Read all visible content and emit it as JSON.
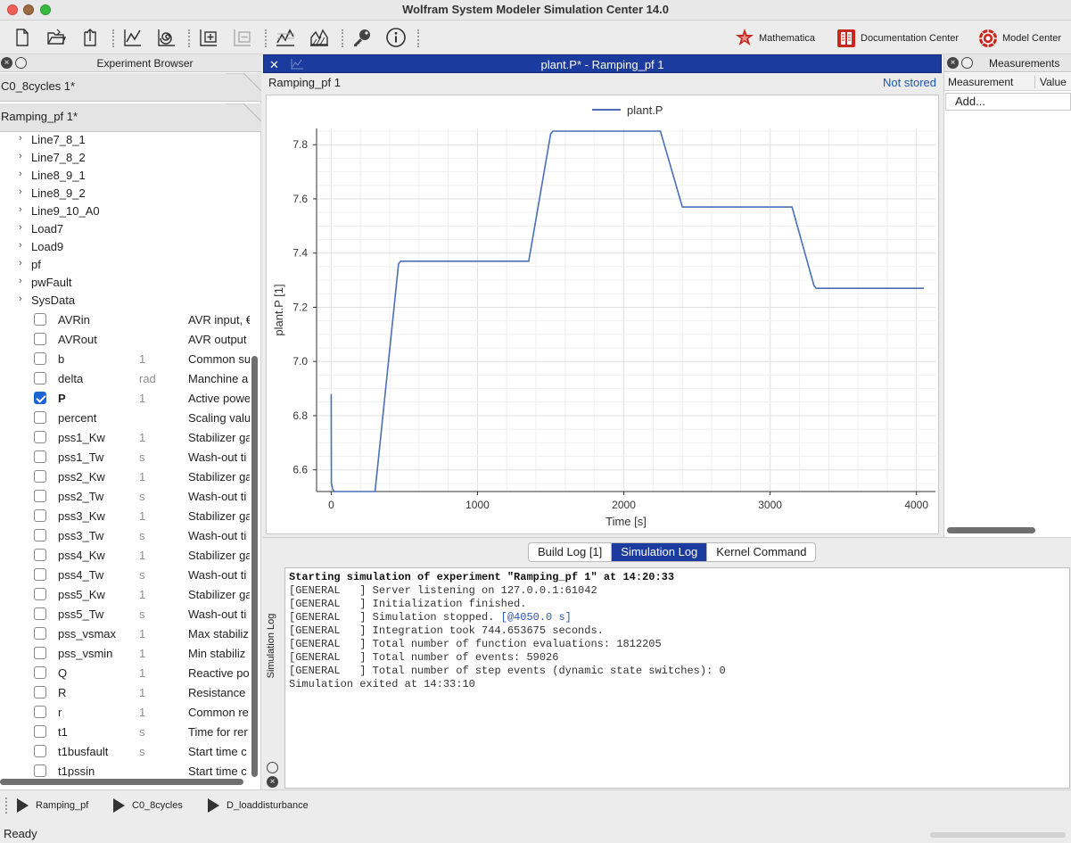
{
  "window": {
    "title": "Wolfram System Modeler Simulation Center 14.0"
  },
  "toolbar": {
    "icons": [
      "new-file-icon",
      "open-folder-icon",
      "export-icon",
      "plot-icon",
      "spiral-plot-icon",
      "add-plot-icon",
      "remove-plot-icon",
      "line-chart-icon",
      "area-chart-icon",
      "key-icon",
      "info-icon"
    ],
    "apps": [
      {
        "label": "Mathematica",
        "icon": "mathematica-icon"
      },
      {
        "label": "Documentation Center",
        "icon": "documentation-icon"
      },
      {
        "label": "Model Center",
        "icon": "model-center-icon"
      }
    ],
    "accent": "#c8281d"
  },
  "experiment_browser": {
    "title": "Experiment Browser",
    "experiments": [
      "C0_8cycles 1*",
      "Ramping_pf 1*"
    ],
    "tree_nodes": [
      "Line7_8_1",
      "Line7_8_2",
      "Line8_9_1",
      "Line8_9_2",
      "Line9_10_A0",
      "Load7",
      "Load9",
      "pf",
      "pwFault",
      "SysData"
    ],
    "variables": [
      {
        "name": "AVRin",
        "unit": "",
        "desc": "AVR input, €",
        "checked": false
      },
      {
        "name": "AVRout",
        "unit": "",
        "desc": "AVR output",
        "checked": false
      },
      {
        "name": "b",
        "unit": "1",
        "desc": "Common su",
        "checked": false
      },
      {
        "name": "delta",
        "unit": "rad",
        "desc": "Manchine a",
        "checked": false
      },
      {
        "name": "P",
        "unit": "1",
        "desc": "Active powe",
        "checked": true
      },
      {
        "name": "percent",
        "unit": "",
        "desc": "Scaling valu",
        "checked": false
      },
      {
        "name": "pss1_Kw",
        "unit": "1",
        "desc": "Stabilizer ga",
        "checked": false
      },
      {
        "name": "pss1_Tw",
        "unit": "s",
        "desc": "Wash-out ti",
        "checked": false
      },
      {
        "name": "pss2_Kw",
        "unit": "1",
        "desc": "Stabilizer ga",
        "checked": false
      },
      {
        "name": "pss2_Tw",
        "unit": "s",
        "desc": "Wash-out ti",
        "checked": false
      },
      {
        "name": "pss3_Kw",
        "unit": "1",
        "desc": "Stabilizer ga",
        "checked": false
      },
      {
        "name": "pss3_Tw",
        "unit": "s",
        "desc": "Wash-out ti",
        "checked": false
      },
      {
        "name": "pss4_Kw",
        "unit": "1",
        "desc": "Stabilizer ga",
        "checked": false
      },
      {
        "name": "pss4_Tw",
        "unit": "s",
        "desc": "Wash-out ti",
        "checked": false
      },
      {
        "name": "pss5_Kw",
        "unit": "1",
        "desc": "Stabilizer ga",
        "checked": false
      },
      {
        "name": "pss5_Tw",
        "unit": "s",
        "desc": "Wash-out ti",
        "checked": false
      },
      {
        "name": "pss_vsmax",
        "unit": "1",
        "desc": "Max stabiliz",
        "checked": false
      },
      {
        "name": "pss_vsmin",
        "unit": "1",
        "desc": "Min stabiliz",
        "checked": false
      },
      {
        "name": "Q",
        "unit": "1",
        "desc": "Reactive po",
        "checked": false
      },
      {
        "name": "R",
        "unit": "1",
        "desc": "Resistance",
        "checked": false
      },
      {
        "name": "r",
        "unit": "1",
        "desc": "Common re",
        "checked": false
      },
      {
        "name": "t1",
        "unit": "s",
        "desc": "Time for rer",
        "checked": false
      },
      {
        "name": "t1busfault",
        "unit": "s",
        "desc": "Start time c",
        "checked": false
      },
      {
        "name": "t1pssin",
        "unit": "",
        "desc": "Start time c",
        "checked": false
      }
    ]
  },
  "plot_window": {
    "title": "plant.P* - Ramping_pf 1",
    "experiment_label": "Ramping_pf 1",
    "storage_status": "Not stored",
    "accent": "#1c3b9e"
  },
  "chart_data": {
    "type": "line",
    "xlabel": "Time [s]",
    "ylabel": "plant.P [1]",
    "xlim": [
      -100,
      4130
    ],
    "ylim": [
      6.52,
      7.86
    ],
    "xticks": [
      0,
      1000,
      2000,
      3000,
      4000
    ],
    "yticks": [
      6.6,
      6.8,
      7.0,
      7.2,
      7.4,
      7.6,
      7.8
    ],
    "grid": true,
    "legend_position": "top-center",
    "series": [
      {
        "name": "plant.P",
        "color": "#4a6fb5",
        "x": [
          0,
          1,
          10,
          20,
          300,
          460,
          475,
          1350,
          1500,
          1515,
          2250,
          2400,
          2415,
          3150,
          3300,
          3315,
          4050
        ],
        "y": [
          6.88,
          6.55,
          6.53,
          6.52,
          6.52,
          7.36,
          7.37,
          7.37,
          7.84,
          7.85,
          7.85,
          7.57,
          7.57,
          7.57,
          7.28,
          7.27,
          7.27
        ]
      }
    ]
  },
  "measurements": {
    "title": "Measurements",
    "columns": [
      "Measurement",
      "Value"
    ],
    "add_label": "Add..."
  },
  "log": {
    "side_label": "Simulation Log",
    "tabs": [
      "Build Log [1]",
      "Simulation Log",
      "Kernel Command"
    ],
    "active_tab": 1,
    "lines": [
      {
        "text": "Starting simulation of experiment \"Ramping_pf 1\" at 14:20:33",
        "style": "bold"
      },
      {
        "text": "[GENERAL   ] Server listening on 127.0.0.1:61042"
      },
      {
        "text": "[GENERAL   ] Initialization finished."
      },
      {
        "text": "[GENERAL   ] Simulation stopped. ",
        "highlight": "[@4050.0 s]"
      },
      {
        "text": "[GENERAL   ] Integration took 744.653675 seconds."
      },
      {
        "text": "[GENERAL   ] Total number of function evaluations: 1812205"
      },
      {
        "text": "[GENERAL   ] Total number of events: 59026"
      },
      {
        "text": "[GENERAL   ] Total number of step events (dynamic state switches): 0"
      },
      {
        "text": "Simulation exited at 14:33:10"
      }
    ]
  },
  "run_bar": {
    "items": [
      "Ramping_pf",
      "C0_8cycles",
      "D_loaddisturbance"
    ]
  },
  "status": {
    "text": "Ready"
  }
}
